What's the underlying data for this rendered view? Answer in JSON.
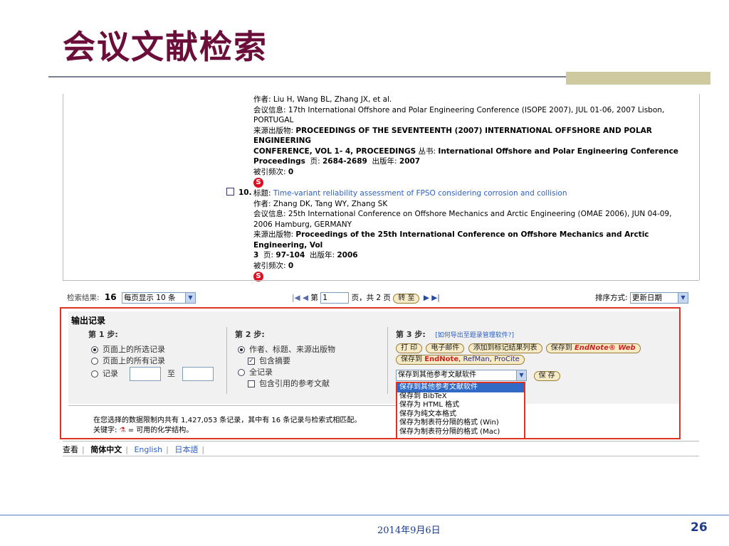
{
  "slide": {
    "title": "会议文献检索",
    "date": "2014年9月6日",
    "page_number": "26"
  },
  "record9": {
    "authors_label": "作者:",
    "authors": "Liu H, Wang BL, Zhang JX, et al.",
    "conf_label": "会议信息:",
    "conf": "17th International Offshore and Polar Engineering Conference (ISOPE 2007), JUL 01-06, 2007 Lisbon,",
    "conf2": "PORTUGAL",
    "source_label": "来源出版物:",
    "source1": "PROCEEDINGS OF THE SEVENTEENTH (2007) INTERNATIONAL OFFSHORE AND POLAR ENGINEERING",
    "source2": "CONFERENCE, VOL 1- 4, PROCEEDINGS",
    "series_label": "丛书:",
    "series": "International Offshore and Polar Engineering Conference",
    "series2": "Proceedings",
    "page_label": "页:",
    "pages": "2684-2689",
    "year_label": "出版年:",
    "year": "2007",
    "cited_label": "被引频次:",
    "cited": "0"
  },
  "record10": {
    "number": "10.",
    "title_label": "标题:",
    "title": "Time-variant reliability assessment of FPSO considering corrosion and collision",
    "authors_label": "作者:",
    "authors": "Zhang DK, Tang WY, Zhang SK",
    "conf_label": "会议信息:",
    "conf": "25th International Conference on Offshore Mechanics and Arctic Engineering (OMAE 2006), JUN 04-09,",
    "conf2": "2006 Hamburg, GERMANY",
    "source_label": "来源出版物:",
    "source1": "Proceedings of the 25th International Conference on Offshore Mechanics and Arctic Engineering, Vol",
    "source2": "3",
    "page_label": "页:",
    "pages": "97-104",
    "year_label": "出版年:",
    "year": "2006",
    "cited_label": "被引频次:",
    "cited": "0"
  },
  "logo_glyph": "S",
  "results_bar": {
    "results_label": "检索结果:",
    "results_count": "16",
    "per_page": "每页显示 10 条",
    "page_label": "第",
    "page_value": "1",
    "page_total": "页，共 2 页",
    "go_button": "转 至",
    "sort_label": "排序方式:",
    "sort_value": "更新日期"
  },
  "output": {
    "heading": "输出记录",
    "step1": {
      "label": "第 1 步:",
      "opt1": "页面上的所选记录",
      "opt2": "页面上的所有记录",
      "opt3": "记录",
      "to": "至"
    },
    "step2": {
      "label": "第 2 步:",
      "opt1": "作者、标题、来源出版物",
      "chk1": "包含摘要",
      "opt2": "全记录",
      "chk2": "包含引用的参考文献"
    },
    "step3": {
      "label": "第 3 步:",
      "help_link": "[如何导出至题录管理软件?]",
      "btn_print": "打 印",
      "btn_email": "电子邮件",
      "btn_marked": "添加到标记结果列表",
      "btn_save_endnote_web": "保存到",
      "endnote_web": "EndNote® Web",
      "btn_save_to": "保存到",
      "endnote": "EndNote",
      "refman": "RefMan",
      "procite": "ProCite",
      "select_value": "保存到其他参考文献软件",
      "btn_save": "保 存",
      "options": [
        "保存到其他参考文献软件",
        "保存到 BibTeX",
        "保存为 HTML 格式",
        "保存为纯文本格式",
        "保存为制表符分隔的格式 (Win)",
        "保存为制表符分隔的格式 (Mac)"
      ]
    }
  },
  "notice": {
    "line1": "在您选择的数据限制内共有 1,427,053 条记录，其中有 16 条记录与检索式相匹配。",
    "line2_prefix": "关键字:",
    "line2_suffix": "= 可用的化学结构。"
  },
  "lang_bar": {
    "view": "查看",
    "simplified": "简体中文",
    "english": "English",
    "japanese": "日本語"
  },
  "colors": {
    "title": "#6b0f3a",
    "link": "#2f5fbf",
    "highlight": "#d32"
  }
}
